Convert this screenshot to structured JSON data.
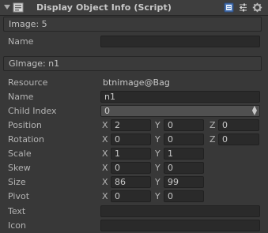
{
  "header": {
    "title": "Display Object Info (Script)",
    "icons": [
      "foldout-arrow-icon",
      "script-component-icon",
      "help-book-icon",
      "preset-sliders-icon",
      "gear-icon"
    ]
  },
  "display_section": {
    "label": "Image: 5"
  },
  "display_name": {
    "label": "Name",
    "value": ""
  },
  "gimage_section": {
    "label": "GImage: n1"
  },
  "resource": {
    "label": "Resource",
    "value": "btnimage@Bag"
  },
  "name": {
    "label": "Name",
    "value": "n1"
  },
  "child_index": {
    "label": "Child Index",
    "value": "0"
  },
  "position": {
    "label": "Position",
    "x_label": "X",
    "x": "2",
    "y_label": "Y",
    "y": "0",
    "z_label": "Z",
    "z": "0"
  },
  "rotation": {
    "label": "Rotation",
    "x_label": "X",
    "x": "0",
    "y_label": "Y",
    "y": "0",
    "z_label": "Z",
    "z": "0"
  },
  "scale": {
    "label": "Scale",
    "x_label": "X",
    "x": "1",
    "y_label": "Y",
    "y": "1"
  },
  "skew": {
    "label": "Skew",
    "x_label": "X",
    "x": "0",
    "y_label": "Y",
    "y": "0"
  },
  "size": {
    "label": "Size",
    "x_label": "X",
    "x": "86",
    "y_label": "Y",
    "y": "99"
  },
  "pivot": {
    "label": "Pivot",
    "x_label": "X",
    "x": "0",
    "y_label": "Y",
    "y": "0"
  },
  "text": {
    "label": "Text",
    "value": ""
  },
  "icon": {
    "label": "Icon",
    "value": ""
  }
}
